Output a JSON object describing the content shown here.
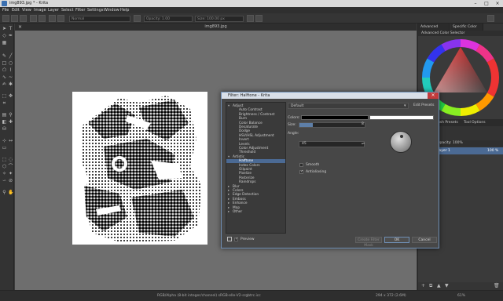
{
  "window": {
    "title": "img893.jpg * - Krita"
  },
  "menu": [
    "File",
    "Edit",
    "View",
    "Image",
    "Layer",
    "Select",
    "Filter",
    "Settings",
    "Window",
    "Help"
  ],
  "toolbar": {
    "blend_mode": "Normal",
    "opacity_label": "Opacity: 1.00",
    "size_label": "Size: 100.00 px"
  },
  "canvas": {
    "tab_title": "img893.jpg"
  },
  "docker": {
    "tab_advanced": "Advanced Color S...",
    "tab_specific": "Specific Color S...",
    "header_color": "Advanced Color Selector",
    "brush_presets_tab": "Brush Presets",
    "tool_options_tab": "Tool Options",
    "opacity_label": "Opacity: 100%",
    "layer_name": "Layer 1",
    "layer_zoom": "100 %"
  },
  "dialog": {
    "title": "Filter: Halftone - Krita",
    "preset": "Default",
    "edit_presets": "Edit Presets",
    "labels": {
      "colors": "Colors:",
      "size": "Size:",
      "angle": "Angle:",
      "smooth": "Smooth",
      "antialiasing": "Antialiasing"
    },
    "size_value": "8",
    "angle_value": "45",
    "tree": [
      {
        "label": "Adjust",
        "level": 0,
        "expanded": true
      },
      {
        "label": "Auto Contrast",
        "level": 1
      },
      {
        "label": "Brightness / Contrast",
        "level": 1
      },
      {
        "label": "Burn",
        "level": 1
      },
      {
        "label": "Color Balance",
        "level": 1
      },
      {
        "label": "Desaturate",
        "level": 1
      },
      {
        "label": "Dodge",
        "level": 1
      },
      {
        "label": "HSV/HSL Adjustment",
        "level": 1
      },
      {
        "label": "Invert",
        "level": 1
      },
      {
        "label": "Levels",
        "level": 1
      },
      {
        "label": "Color Adjustment",
        "level": 1
      },
      {
        "label": "Threshold",
        "level": 1
      },
      {
        "label": "Artistic",
        "level": 0,
        "expanded": true
      },
      {
        "label": "Halftone",
        "level": 1,
        "selected": true
      },
      {
        "label": "Index Colors",
        "level": 1
      },
      {
        "label": "Oilpaint",
        "level": 1
      },
      {
        "label": "Pixelize",
        "level": 1
      },
      {
        "label": "Posterize",
        "level": 1
      },
      {
        "label": "Raindrops",
        "level": 1
      },
      {
        "label": "Blur",
        "level": 0
      },
      {
        "label": "Colors",
        "level": 0
      },
      {
        "label": "Edge Detection",
        "level": 0
      },
      {
        "label": "Emboss",
        "level": 0
      },
      {
        "label": "Enhance",
        "level": 0
      },
      {
        "label": "Map",
        "level": 0
      },
      {
        "label": "Other",
        "level": 0
      }
    ],
    "preview_label": "Preview",
    "create_mask": "Create Filter Mask",
    "ok": "OK",
    "cancel": "Cancel"
  },
  "status": {
    "color_info": "RGB/Alpha (8-bit integer/channel)  sRGB-elle-V2-srgbtrc.icc",
    "dimensions": "294 x 372 (2.6M)",
    "zoom": "61%"
  },
  "colors": {
    "selection": "#4b6a94",
    "dialog_border": "#6f8fb5",
    "close_button": "#c23b3b"
  }
}
